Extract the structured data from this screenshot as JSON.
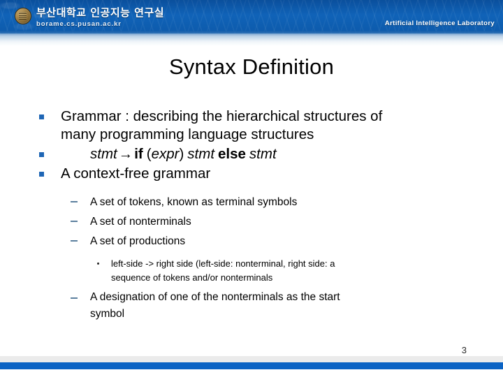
{
  "header": {
    "logo_icon": "university-seal-icon",
    "korean_title": "부산대학교 인공지능 연구실",
    "url": "borame.cs.pusan.ac.kr",
    "lab_name": "Artificial Intelligence Laboratory",
    "banner_color": "#0c57a8"
  },
  "slide": {
    "title": "Syntax Definition",
    "page_number": "3"
  },
  "bullets": {
    "b1_line1": "Grammar : describing the hierarchical structures of",
    "b1_line2": "many programming language structures",
    "rule": {
      "lhs": "stmt",
      "arrow": "→",
      "kw_if": "if",
      "open_paren": "(",
      "expr": "expr",
      "close_paren": ")",
      "stmt_then": "stmt",
      "kw_else": "else",
      "stmt_else": "stmt"
    },
    "b3": "A context-free grammar",
    "sub": [
      "A set of tokens, known as terminal symbols",
      "A set of nonterminals",
      "A set of productions"
    ],
    "sub_detail_line1": "left-side -> right side (left-side: nonterminal, right side: a",
    "sub_detail_line2": "sequence of tokens and/or nonterminals",
    "sub_last_line1": "A designation of one of the nonterminals as the start",
    "sub_last_line2": "symbol"
  },
  "footer": {
    "gray_bar_color": "#ebebeb",
    "blue_bar_color": "#0b63c4"
  }
}
